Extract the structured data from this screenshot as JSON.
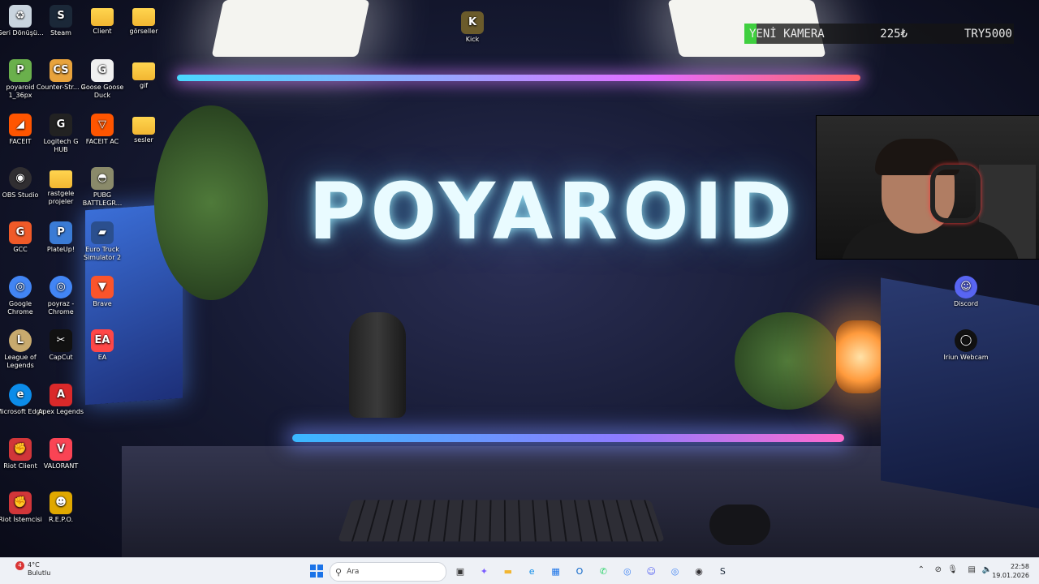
{
  "wallpaper": {
    "brand_text": "POYAROID"
  },
  "stream_overlay": {
    "goal_title": "YENİ KAMERA",
    "goal_current": "225₺",
    "goal_target": "TRY5000",
    "goal_progress_fraction": 0.045,
    "accent_color": "#3fcf3f"
  },
  "desktop_icons": [
    {
      "label": "Geri Dönüşü...",
      "icon": "recycle-bin-icon",
      "color": "#c9d4de"
    },
    {
      "label": "Steam",
      "icon": "steam-icon",
      "color": "#1b2838"
    },
    {
      "label": "Client",
      "icon": "folder-icon",
      "color": "#f2b632"
    },
    {
      "label": "görseller",
      "icon": "folder-icon",
      "color": "#f2b632"
    },
    {
      "label": "Kick",
      "icon": "kick-icon",
      "color": "#6b5b2b"
    },
    {
      "label": "poyaroid 1_36px",
      "icon": "poyaroid-icon",
      "color": "#6ab04c"
    },
    {
      "label": "Counter-Str... 2",
      "icon": "counter-strike-icon",
      "color": "#e8a33c"
    },
    {
      "label": "Goose Goose Duck",
      "icon": "goose-icon",
      "color": "#f0f0f0"
    },
    {
      "label": "gif",
      "icon": "folder-icon",
      "color": "#f2b632"
    },
    {
      "label": "FACEIT",
      "icon": "faceit-icon",
      "color": "#ff5500"
    },
    {
      "label": "Logitech G HUB",
      "icon": "logitech-icon",
      "color": "#222222"
    },
    {
      "label": "FACEIT AC",
      "icon": "faceit-ac-icon",
      "color": "#ff5500"
    },
    {
      "label": "sesler",
      "icon": "folder-icon",
      "color": "#f2b632"
    },
    {
      "label": "OBS Studio",
      "icon": "obs-icon",
      "color": "#302e31"
    },
    {
      "label": "rastgele projeler",
      "icon": "folder-icon",
      "color": "#f2b632"
    },
    {
      "label": "PUBG BATTLEGR...",
      "icon": "pubg-icon",
      "color": "#8a8a6a"
    },
    {
      "label": "GCC",
      "icon": "gcc-icon",
      "color": "#f05a28"
    },
    {
      "label": "PlateUp!",
      "icon": "plateup-icon",
      "color": "#3a7bd5"
    },
    {
      "label": "Euro Truck Simulator 2",
      "icon": "truck-icon",
      "color": "#2b4f8e"
    },
    {
      "label": "Google Chrome",
      "icon": "chrome-icon",
      "color": "#4285f4"
    },
    {
      "label": "poyraz - Chrome",
      "icon": "chrome-profile-icon",
      "color": "#4285f4"
    },
    {
      "label": "Brave",
      "icon": "brave-icon",
      "color": "#fb542b"
    },
    {
      "label": "League of Legends",
      "icon": "league-icon",
      "color": "#c8aa6e"
    },
    {
      "label": "CapCut",
      "icon": "capcut-icon",
      "color": "#111111"
    },
    {
      "label": "EA",
      "icon": "ea-icon",
      "color": "#ff4747"
    },
    {
      "label": "Microsoft Edge",
      "icon": "edge-icon",
      "color": "#0c8ce9"
    },
    {
      "label": "Apex Legends",
      "icon": "apex-icon",
      "color": "#da292a"
    },
    {
      "label": "Riot Client",
      "icon": "riot-icon",
      "color": "#d13639"
    },
    {
      "label": "VALORANT",
      "icon": "valorant-icon",
      "color": "#fa4454"
    },
    {
      "label": "Riot İstemcisi",
      "icon": "riot-icon",
      "color": "#d13639"
    },
    {
      "label": "R.E.P.O.",
      "icon": "repo-icon",
      "color": "#e0a800"
    },
    {
      "label": "Discord",
      "icon": "discord-icon",
      "color": "#5865f2"
    },
    {
      "label": "Iriun Webcam",
      "icon": "iriun-icon",
      "color": "#111111"
    }
  ],
  "taskbar": {
    "weather": {
      "temp": "4°C",
      "condition": "Bulutlu",
      "badge": "4"
    },
    "search_placeholder": "Ara",
    "pinned": [
      {
        "icon": "task-view-icon",
        "color": "#333333"
      },
      {
        "icon": "copilot-icon",
        "color": "#7a5cff"
      },
      {
        "icon": "file-explorer-icon",
        "color": "#f2b632"
      },
      {
        "icon": "edge-icon",
        "color": "#0c8ce9"
      },
      {
        "icon": "store-icon",
        "color": "#1a73e8"
      },
      {
        "icon": "outlook-icon",
        "color": "#0a64c8"
      },
      {
        "icon": "whatsapp-icon",
        "color": "#25d366"
      },
      {
        "icon": "chrome-icon",
        "color": "#4285f4"
      },
      {
        "icon": "discord-icon",
        "color": "#5865f2"
      },
      {
        "icon": "chrome-profile-icon",
        "color": "#4285f4"
      },
      {
        "icon": "obs-icon",
        "color": "#302e31"
      },
      {
        "icon": "steam-icon",
        "color": "#1b2838"
      }
    ],
    "clock": {
      "time": "22:58",
      "date": "19.01.2026"
    }
  }
}
